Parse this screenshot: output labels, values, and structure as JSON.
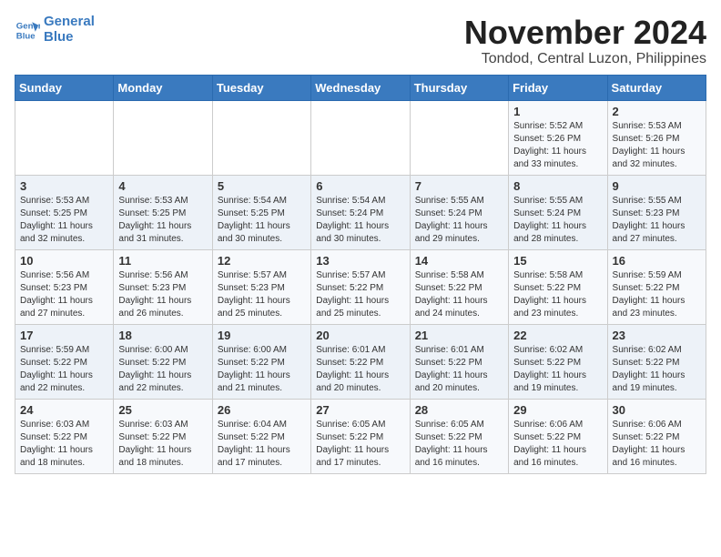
{
  "logo": {
    "line1": "General",
    "line2": "Blue"
  },
  "title": "November 2024",
  "subtitle": "Tondod, Central Luzon, Philippines",
  "headers": [
    "Sunday",
    "Monday",
    "Tuesday",
    "Wednesday",
    "Thursday",
    "Friday",
    "Saturday"
  ],
  "weeks": [
    [
      {
        "day": "",
        "info": ""
      },
      {
        "day": "",
        "info": ""
      },
      {
        "day": "",
        "info": ""
      },
      {
        "day": "",
        "info": ""
      },
      {
        "day": "",
        "info": ""
      },
      {
        "day": "1",
        "info": "Sunrise: 5:52 AM\nSunset: 5:26 PM\nDaylight: 11 hours\nand 33 minutes."
      },
      {
        "day": "2",
        "info": "Sunrise: 5:53 AM\nSunset: 5:26 PM\nDaylight: 11 hours\nand 32 minutes."
      }
    ],
    [
      {
        "day": "3",
        "info": "Sunrise: 5:53 AM\nSunset: 5:25 PM\nDaylight: 11 hours\nand 32 minutes."
      },
      {
        "day": "4",
        "info": "Sunrise: 5:53 AM\nSunset: 5:25 PM\nDaylight: 11 hours\nand 31 minutes."
      },
      {
        "day": "5",
        "info": "Sunrise: 5:54 AM\nSunset: 5:25 PM\nDaylight: 11 hours\nand 30 minutes."
      },
      {
        "day": "6",
        "info": "Sunrise: 5:54 AM\nSunset: 5:24 PM\nDaylight: 11 hours\nand 30 minutes."
      },
      {
        "day": "7",
        "info": "Sunrise: 5:55 AM\nSunset: 5:24 PM\nDaylight: 11 hours\nand 29 minutes."
      },
      {
        "day": "8",
        "info": "Sunrise: 5:55 AM\nSunset: 5:24 PM\nDaylight: 11 hours\nand 28 minutes."
      },
      {
        "day": "9",
        "info": "Sunrise: 5:55 AM\nSunset: 5:23 PM\nDaylight: 11 hours\nand 27 minutes."
      }
    ],
    [
      {
        "day": "10",
        "info": "Sunrise: 5:56 AM\nSunset: 5:23 PM\nDaylight: 11 hours\nand 27 minutes."
      },
      {
        "day": "11",
        "info": "Sunrise: 5:56 AM\nSunset: 5:23 PM\nDaylight: 11 hours\nand 26 minutes."
      },
      {
        "day": "12",
        "info": "Sunrise: 5:57 AM\nSunset: 5:23 PM\nDaylight: 11 hours\nand 25 minutes."
      },
      {
        "day": "13",
        "info": "Sunrise: 5:57 AM\nSunset: 5:22 PM\nDaylight: 11 hours\nand 25 minutes."
      },
      {
        "day": "14",
        "info": "Sunrise: 5:58 AM\nSunset: 5:22 PM\nDaylight: 11 hours\nand 24 minutes."
      },
      {
        "day": "15",
        "info": "Sunrise: 5:58 AM\nSunset: 5:22 PM\nDaylight: 11 hours\nand 23 minutes."
      },
      {
        "day": "16",
        "info": "Sunrise: 5:59 AM\nSunset: 5:22 PM\nDaylight: 11 hours\nand 23 minutes."
      }
    ],
    [
      {
        "day": "17",
        "info": "Sunrise: 5:59 AM\nSunset: 5:22 PM\nDaylight: 11 hours\nand 22 minutes."
      },
      {
        "day": "18",
        "info": "Sunrise: 6:00 AM\nSunset: 5:22 PM\nDaylight: 11 hours\nand 22 minutes."
      },
      {
        "day": "19",
        "info": "Sunrise: 6:00 AM\nSunset: 5:22 PM\nDaylight: 11 hours\nand 21 minutes."
      },
      {
        "day": "20",
        "info": "Sunrise: 6:01 AM\nSunset: 5:22 PM\nDaylight: 11 hours\nand 20 minutes."
      },
      {
        "day": "21",
        "info": "Sunrise: 6:01 AM\nSunset: 5:22 PM\nDaylight: 11 hours\nand 20 minutes."
      },
      {
        "day": "22",
        "info": "Sunrise: 6:02 AM\nSunset: 5:22 PM\nDaylight: 11 hours\nand 19 minutes."
      },
      {
        "day": "23",
        "info": "Sunrise: 6:02 AM\nSunset: 5:22 PM\nDaylight: 11 hours\nand 19 minutes."
      }
    ],
    [
      {
        "day": "24",
        "info": "Sunrise: 6:03 AM\nSunset: 5:22 PM\nDaylight: 11 hours\nand 18 minutes."
      },
      {
        "day": "25",
        "info": "Sunrise: 6:03 AM\nSunset: 5:22 PM\nDaylight: 11 hours\nand 18 minutes."
      },
      {
        "day": "26",
        "info": "Sunrise: 6:04 AM\nSunset: 5:22 PM\nDaylight: 11 hours\nand 17 minutes."
      },
      {
        "day": "27",
        "info": "Sunrise: 6:05 AM\nSunset: 5:22 PM\nDaylight: 11 hours\nand 17 minutes."
      },
      {
        "day": "28",
        "info": "Sunrise: 6:05 AM\nSunset: 5:22 PM\nDaylight: 11 hours\nand 16 minutes."
      },
      {
        "day": "29",
        "info": "Sunrise: 6:06 AM\nSunset: 5:22 PM\nDaylight: 11 hours\nand 16 minutes."
      },
      {
        "day": "30",
        "info": "Sunrise: 6:06 AM\nSunset: 5:22 PM\nDaylight: 11 hours\nand 16 minutes."
      }
    ]
  ]
}
